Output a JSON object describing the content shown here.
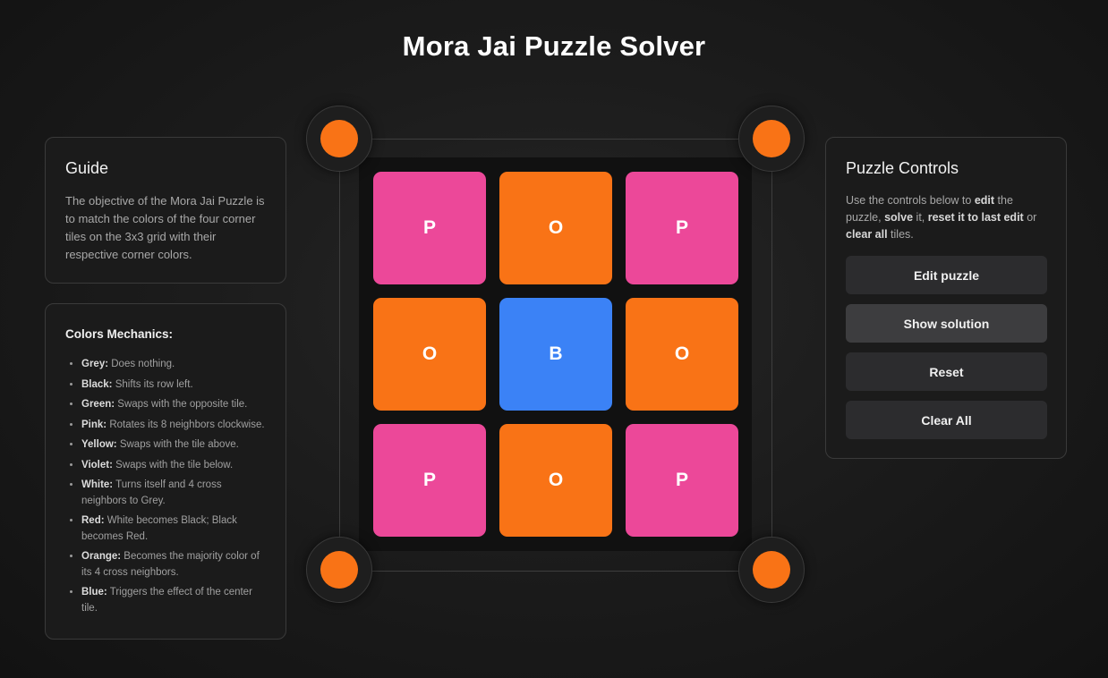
{
  "page": {
    "title": "Mora Jai Puzzle Solver"
  },
  "guide": {
    "heading": "Guide",
    "text": "The objective of the Mora Jai Puzzle is to match the colors of the four corner tiles on the 3x3 grid with their respective corner colors."
  },
  "mechanics": {
    "heading": "Colors Mechanics:",
    "items": [
      {
        "name": "Grey:",
        "desc": " Does nothing."
      },
      {
        "name": "Black:",
        "desc": " Shifts its row left."
      },
      {
        "name": "Green:",
        "desc": " Swaps with the opposite tile."
      },
      {
        "name": "Pink:",
        "desc": " Rotates its 8 neighbors clockwise."
      },
      {
        "name": "Yellow:",
        "desc": " Swaps with the tile above."
      },
      {
        "name": "Violet:",
        "desc": " Swaps with the tile below."
      },
      {
        "name": "White:",
        "desc": " Turns itself and 4 cross neighbors to Grey."
      },
      {
        "name": "Red:",
        "desc": " White becomes Black; Black becomes Red."
      },
      {
        "name": "Orange:",
        "desc": " Becomes the majority color of its 4 cross neighbors."
      },
      {
        "name": "Blue:",
        "desc": " Triggers the effect of the center tile."
      }
    ]
  },
  "controls": {
    "heading": "Puzzle Controls",
    "desc_1": "Use the controls below to ",
    "desc_edit": "edit",
    "desc_2": " the puzzle, ",
    "desc_solve": "solve",
    "desc_3": " it, ",
    "desc_reset": "reset it to last edit",
    "desc_4": " or ",
    "desc_clear": "clear all",
    "desc_5": " tiles.",
    "buttons": {
      "edit": "Edit puzzle",
      "solution": "Show solution",
      "reset": "Reset",
      "clear": "Clear All"
    }
  },
  "grid": {
    "tiles": [
      {
        "label": "P",
        "color": "#ec4899"
      },
      {
        "label": "O",
        "color": "#f97316"
      },
      {
        "label": "P",
        "color": "#ec4899"
      },
      {
        "label": "O",
        "color": "#f97316"
      },
      {
        "label": "B",
        "color": "#3b82f6"
      },
      {
        "label": "O",
        "color": "#f97316"
      },
      {
        "label": "P",
        "color": "#ec4899"
      },
      {
        "label": "O",
        "color": "#f97316"
      },
      {
        "label": "P",
        "color": "#ec4899"
      }
    ],
    "corners": {
      "top_left": "#f97316",
      "top_right": "#f97316",
      "bottom_left": "#f97316",
      "bottom_right": "#f97316"
    }
  }
}
